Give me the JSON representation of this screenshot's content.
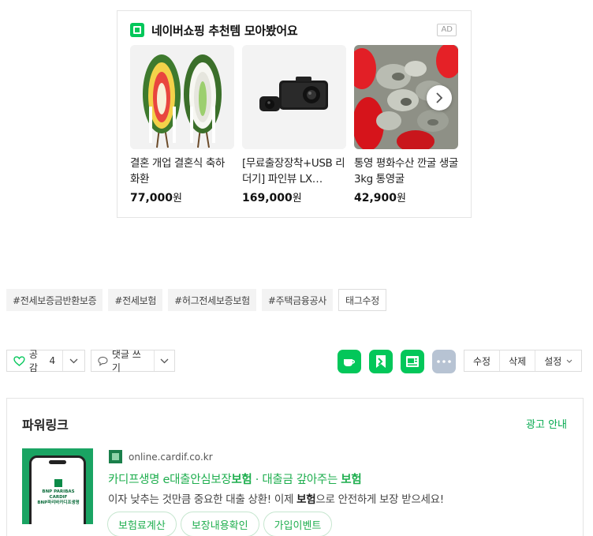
{
  "shopping_ad": {
    "title": "네이버쇼핑 추천템 모아봤어요",
    "badge": "AD",
    "logo_icon": "naver-shopping-icon",
    "products": [
      {
        "name": "결혼 개업 결혼식 축하 화환",
        "price": "77,000",
        "currency": "원"
      },
      {
        "name": "[무료출장장착+USB 리더기] 파인뷰 LX…",
        "price": "169,000",
        "currency": "원"
      },
      {
        "name": "통영 평화수산 깐굴 생굴 3kg 통영굴",
        "price": "42,900",
        "currency": "원"
      }
    ],
    "next_icon": "chevron-right-icon"
  },
  "tags": {
    "items": [
      "#전세보증금반환보증",
      "#전세보험",
      "#허그전세보증보험",
      "#주택금융공사"
    ],
    "edit_label": "태그수정"
  },
  "actions": {
    "like_label": "공감",
    "like_count": "4",
    "comment_label": "댓글 쓰기",
    "share_icons": [
      "naver-cafe-icon",
      "naver-band-icon",
      "naver-blog-icon",
      "more-icon"
    ],
    "edit_label": "수정",
    "delete_label": "삭제",
    "settings_label": "설정",
    "colors": {
      "green": "#03c75a",
      "more_gray": "#b7c3d3"
    }
  },
  "powerlink": {
    "title": "파워링크",
    "ad_info": "광고 안내",
    "thumb_text": "BNP PARIBAS CARDIF",
    "thumb_subtext": "BNP파리바카디프생명",
    "site": "online.cardif.co.kr",
    "headline_parts": [
      "카디프생명 e대출안심보장",
      "보험",
      " · 대출금 갚아주는 ",
      "보험"
    ],
    "desc_parts": [
      "이자 낮추는 것만큼 중요한 대출 상환! 이제 ",
      "보험",
      "으로 안전하게 보장 받으세요!"
    ],
    "chips": [
      "보험료계산",
      "보장내용확인",
      "가입이벤트"
    ],
    "accent": "#1eae4e"
  }
}
